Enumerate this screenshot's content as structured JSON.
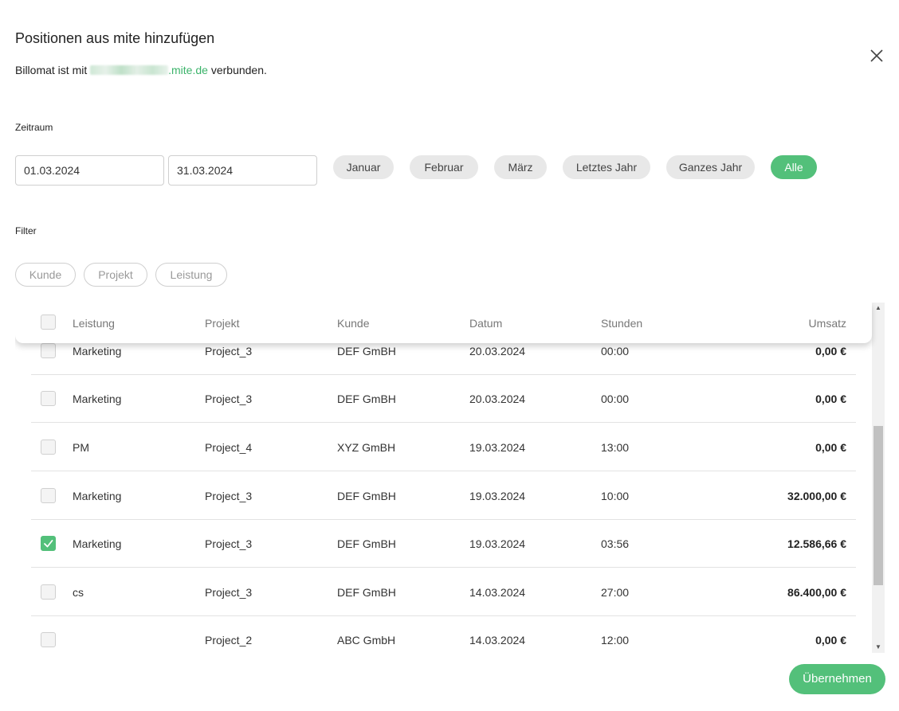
{
  "dialog": {
    "title": "Positionen aus mite hinzufügen",
    "subtitle_prefix": "Billomat ist mit",
    "subtitle_link": ".mite.de",
    "subtitle_suffix": "verbunden."
  },
  "zeitraum": {
    "label": "Zeitraum",
    "from": "01.03.2024",
    "to": "31.03.2024",
    "presets": [
      "Januar",
      "Februar",
      "März",
      "Letztes Jahr",
      "Ganzes Jahr",
      "Alle"
    ],
    "active_preset": "Alle"
  },
  "filter": {
    "label": "Filter",
    "options": [
      "Kunde",
      "Projekt",
      "Leistung"
    ]
  },
  "table": {
    "columns": {
      "leistung": "Leistung",
      "projekt": "Projekt",
      "kunde": "Kunde",
      "datum": "Datum",
      "stunden": "Stunden",
      "umsatz": "Umsatz"
    },
    "rows": [
      {
        "leistung": "Marketing",
        "projekt": "Project_3",
        "kunde": "DEF GmBH",
        "datum": "20.03.2024",
        "stunden": "00:00",
        "umsatz": "0,00 €",
        "checked": false
      },
      {
        "leistung": "Marketing",
        "projekt": "Project_3",
        "kunde": "DEF GmBH",
        "datum": "20.03.2024",
        "stunden": "00:00",
        "umsatz": "0,00 €",
        "checked": false
      },
      {
        "leistung": "PM",
        "projekt": "Project_4",
        "kunde": "XYZ GmBH",
        "datum": "19.03.2024",
        "stunden": "13:00",
        "umsatz": "0,00 €",
        "checked": false
      },
      {
        "leistung": "Marketing",
        "projekt": "Project_3",
        "kunde": "DEF GmBH",
        "datum": "19.03.2024",
        "stunden": "10:00",
        "umsatz": "32.000,00 €",
        "checked": false
      },
      {
        "leistung": "Marketing",
        "projekt": "Project_3",
        "kunde": "DEF GmBH",
        "datum": "19.03.2024",
        "stunden": "03:56",
        "umsatz": "12.586,66 €",
        "checked": true
      },
      {
        "leistung": "cs",
        "projekt": "Project_3",
        "kunde": "DEF GmBH",
        "datum": "14.03.2024",
        "stunden": "27:00",
        "umsatz": "86.400,00 €",
        "checked": false
      },
      {
        "leistung": "",
        "projekt": "Project_2",
        "kunde": "ABC GmbH",
        "datum": "14.03.2024",
        "stunden": "12:00",
        "umsatz": "0,00 €",
        "checked": false
      }
    ]
  },
  "actions": {
    "submit": "Übernehmen"
  },
  "icons": {
    "close": "close-icon",
    "check": "check-icon"
  },
  "colors": {
    "accent": "#53c07a",
    "link": "#3bb36a"
  }
}
